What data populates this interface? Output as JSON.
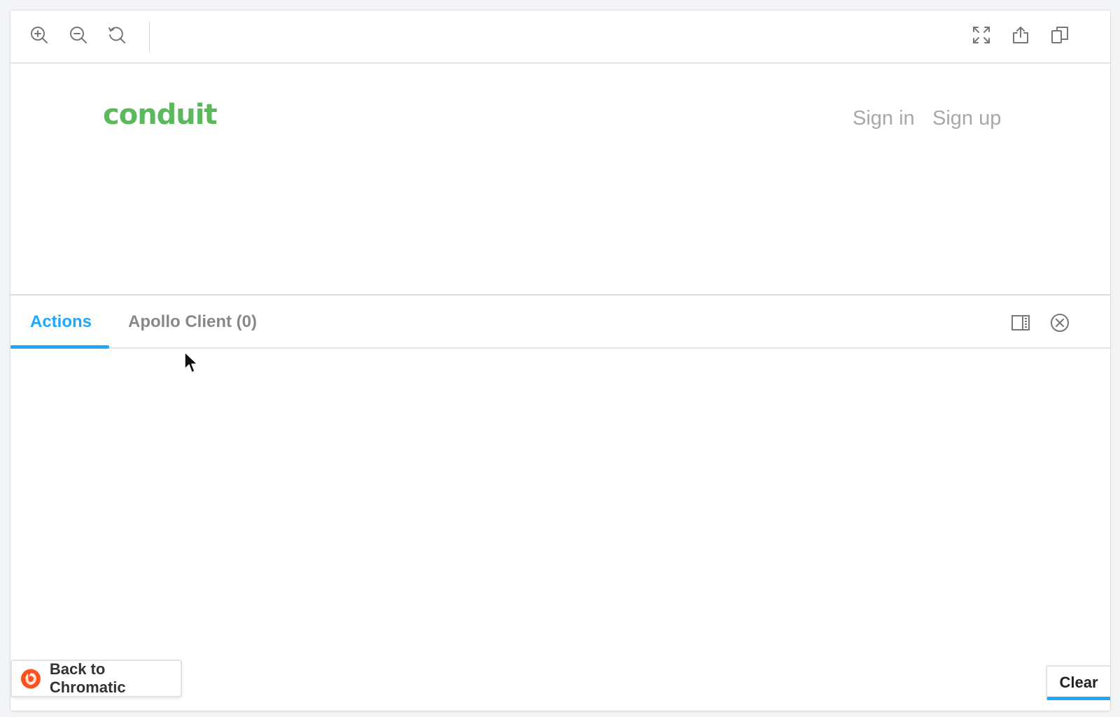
{
  "toolbar": {
    "left_icons": [
      "zoom-in-icon",
      "zoom-out-icon",
      "zoom-reset-icon"
    ],
    "right_icons": [
      "fullscreen-icon",
      "share-icon",
      "copy-icon"
    ]
  },
  "preview": {
    "brand": "conduit",
    "nav": {
      "sign_in": "Sign in",
      "sign_up": "Sign up"
    },
    "colors": {
      "brand": "#5cb85c",
      "nav_link": "#a8a8a8"
    }
  },
  "panel": {
    "tabs": [
      {
        "label": "Actions",
        "active": true
      },
      {
        "label": "Apollo Client (0)",
        "active": false
      }
    ],
    "actions_right": [
      "panel-layout-icon",
      "close-panel-icon"
    ],
    "accent": "#1ea7fd",
    "clear_label": "Clear"
  },
  "back_button": {
    "label": "Back to Chromatic",
    "icon": "chromatic-logo-icon",
    "logo_color": "#fc521f"
  }
}
